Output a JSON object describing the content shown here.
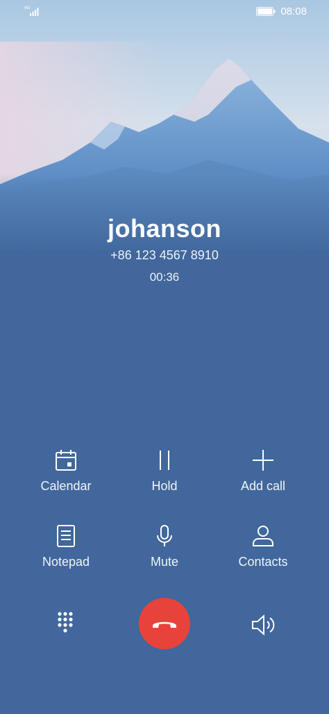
{
  "status_bar": {
    "network": "4G",
    "time": "08:08"
  },
  "call": {
    "name": "johanson",
    "number": "+86 123 4567 8910",
    "duration": "00:36"
  },
  "actions": [
    {
      "label": "Calendar",
      "icon": "calendar-icon"
    },
    {
      "label": "Hold",
      "icon": "pause-icon"
    },
    {
      "label": "Add call",
      "icon": "plus-icon"
    },
    {
      "label": "Notepad",
      "icon": "notepad-icon"
    },
    {
      "label": "Mute",
      "icon": "microphone-icon"
    },
    {
      "label": "Contacts",
      "icon": "person-icon"
    }
  ],
  "controls": {
    "dialpad_icon": "dialpad-icon",
    "end_call_icon": "hang-up-icon",
    "speaker_icon": "speaker-icon"
  },
  "colors": {
    "background": "#41679c",
    "end_call": "#e8433a"
  }
}
